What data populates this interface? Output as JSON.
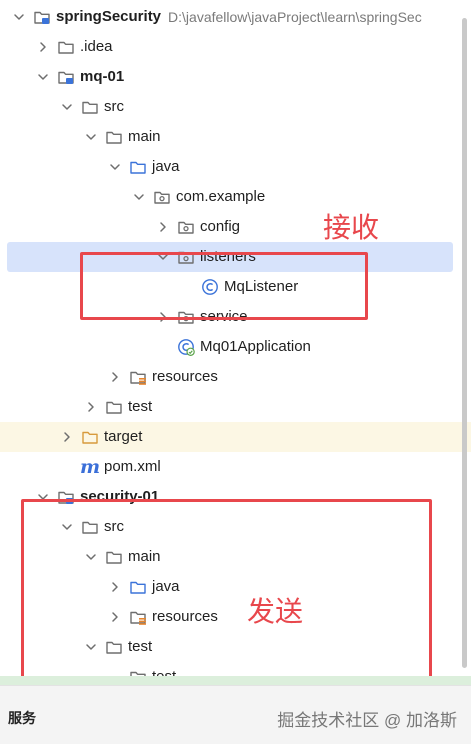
{
  "tree": {
    "rows": [
      {
        "label": "springSecurity",
        "path": "D:\\javafellow\\javaProject\\learn\\springSec",
        "bold": true,
        "indent": 0,
        "arrow": "down",
        "icon": "module-folder-icon"
      },
      {
        "label": ".idea",
        "indent": 1,
        "arrow": "right",
        "icon": "folder-icon"
      },
      {
        "label": "mq-01",
        "bold": true,
        "indent": 1,
        "arrow": "down",
        "icon": "module-folder-icon"
      },
      {
        "label": "src",
        "indent": 2,
        "arrow": "down",
        "icon": "folder-icon"
      },
      {
        "label": "main",
        "indent": 3,
        "arrow": "down",
        "icon": "folder-icon"
      },
      {
        "label": "java",
        "indent": 4,
        "arrow": "down",
        "icon": "source-folder-icon"
      },
      {
        "label": "com.example",
        "indent": 5,
        "arrow": "down",
        "icon": "package-icon"
      },
      {
        "label": "config",
        "indent": 6,
        "arrow": "right",
        "icon": "package-icon"
      },
      {
        "label": "listeners",
        "indent": 6,
        "arrow": "down",
        "icon": "package-icon",
        "selected": true
      },
      {
        "label": "MqListener",
        "indent": 7,
        "arrow": "none",
        "icon": "java-class-icon"
      },
      {
        "label": "service",
        "indent": 6,
        "arrow": "right",
        "icon": "package-icon"
      },
      {
        "label": "Mq01Application",
        "indent": 6,
        "arrow": "none",
        "icon": "spring-app-icon"
      },
      {
        "label": "resources",
        "indent": 4,
        "arrow": "right",
        "icon": "resources-folder-icon"
      },
      {
        "label": "test",
        "indent": 3,
        "arrow": "right",
        "icon": "folder-icon"
      },
      {
        "label": "target",
        "indent": 2,
        "arrow": "right",
        "icon": "excluded-folder-icon",
        "highlight": true
      },
      {
        "label": "pom.xml",
        "indent": 2,
        "arrow": "none",
        "icon": "maven-icon"
      },
      {
        "label": "security-01",
        "bold": true,
        "indent": 1,
        "arrow": "down",
        "icon": "module-folder-icon"
      },
      {
        "label": "src",
        "indent": 2,
        "arrow": "down",
        "icon": "folder-icon"
      },
      {
        "label": "main",
        "indent": 3,
        "arrow": "down",
        "icon": "folder-icon"
      },
      {
        "label": "java",
        "indent": 4,
        "arrow": "right",
        "icon": "source-folder-icon"
      },
      {
        "label": "resources",
        "indent": 4,
        "arrow": "right",
        "icon": "resources-folder-icon"
      },
      {
        "label": "test",
        "indent": 3,
        "arrow": "down",
        "icon": "folder-icon"
      },
      {
        "label": "test",
        "indent": 4,
        "arrow": "none",
        "icon": "folder-icon"
      }
    ]
  },
  "annotations": {
    "receive": "接收",
    "send": "发送"
  },
  "status_bar": {
    "label": "服务"
  },
  "watermark": "掘金技术社区 @ 加洛斯",
  "colors": {
    "selection": "#d7e3fb",
    "highlight": "#fcf7e4",
    "annotation": "#e8474c",
    "folder_blue": "#3b73d9"
  }
}
